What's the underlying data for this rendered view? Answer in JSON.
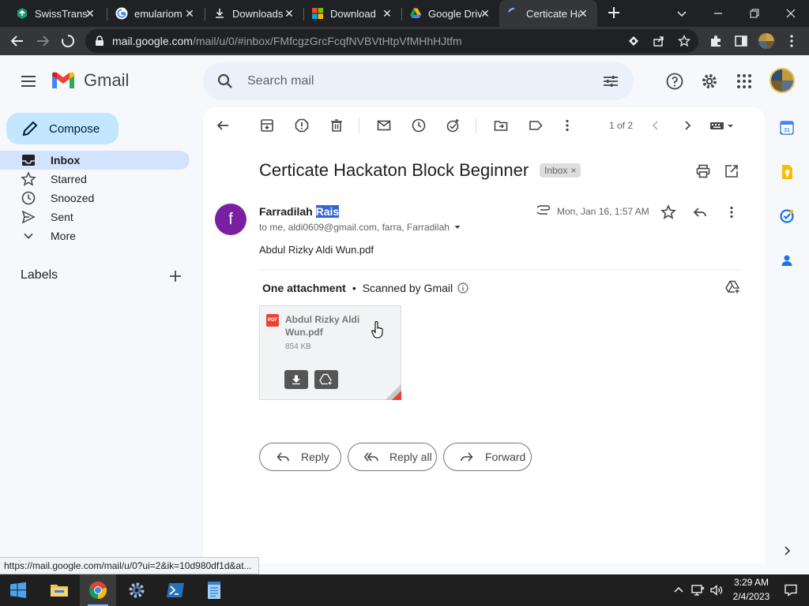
{
  "browser": {
    "tabs": [
      {
        "title": "SwissTransfer",
        "icon": "swisstransfer-icon",
        "active": false
      },
      {
        "title": "emulariom",
        "icon": "google-icon",
        "active": false
      },
      {
        "title": "Downloads",
        "icon": "download-icon",
        "active": false
      },
      {
        "title": "Download",
        "icon": "windows-logo-icon",
        "active": false
      },
      {
        "title": "Google Drive",
        "icon": "google-drive-icon",
        "active": false
      },
      {
        "title": "Certicate Hackaton",
        "icon": "loading-spinner-icon",
        "active": true
      }
    ],
    "url_host": "mail.google.com",
    "url_path": "/mail/u/0/#inbox/FMfcgzGrcFcqfNVBVtHtpVfMHhHJtfm",
    "status_url": "https://mail.google.com/mail/u/0?ui=2&ik=10d980df1d&at..."
  },
  "gmail": {
    "logo_text": "Gmail",
    "search": {
      "placeholder": "Search mail"
    },
    "compose_label": "Compose",
    "nav": [
      {
        "label": "Inbox",
        "icon": "inbox-icon",
        "active": true
      },
      {
        "label": "Starred",
        "icon": "star-icon",
        "active": false
      },
      {
        "label": "Snoozed",
        "icon": "clock-icon",
        "active": false
      },
      {
        "label": "Sent",
        "icon": "send-icon",
        "active": false
      },
      {
        "label": "More",
        "icon": "chevron-down-icon",
        "active": false
      }
    ],
    "labels_title": "Labels",
    "pager": "1 of 2",
    "email": {
      "subject": "Certicate Hackaton Block Beginner",
      "label_chip": "Inbox",
      "sender_initial": "f",
      "sender_first": "Farradilah",
      "sender_last": "Rais",
      "recipients": "to me, aldi0609@gmail.com, farra, Farradilah",
      "date": "Mon, Jan 16, 1:57 AM",
      "body": "Abdul Rizky Aldi Wun.pdf",
      "attachment_header": "One attachment",
      "scanned_text": "Scanned by Gmail",
      "attachment": {
        "name": "Abdul Rizky Aldi Wun.pdf",
        "size": "854 KB",
        "type_badge": "PDF"
      }
    },
    "actions": {
      "reply": "Reply",
      "reply_all": "Reply all",
      "forward": "Forward"
    }
  },
  "taskbar": {
    "time": "3:29 AM",
    "date": "2/4/2023",
    "apps": [
      "file-explorer-icon",
      "chrome-icon",
      "settings-icon",
      "powershell-icon",
      "notepad-icon"
    ]
  }
}
